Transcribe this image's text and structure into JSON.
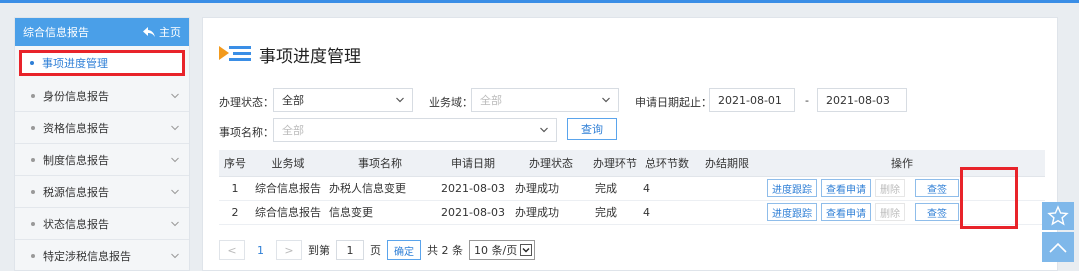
{
  "sidebar": {
    "header_title": "综合信息报告",
    "home_label": "主页",
    "items": [
      {
        "label": "事项进度管理",
        "active": true
      },
      {
        "label": "身份信息报告"
      },
      {
        "label": "资格信息报告"
      },
      {
        "label": "制度信息报告"
      },
      {
        "label": "税源信息报告"
      },
      {
        "label": "状态信息报告"
      },
      {
        "label": "特定涉税信息报告"
      }
    ]
  },
  "main": {
    "title": "事项进度管理",
    "filters": {
      "status_label": "办理状态：",
      "status_value": "全部",
      "domain_label": "业务域：",
      "domain_placeholder": "全部",
      "date_label": "申请日期起止：",
      "date_from": "2021-08-01",
      "date_sep": "-",
      "date_to": "2021-08-03",
      "name_label": "事项名称：",
      "name_placeholder": "全部",
      "query_button": "查询"
    },
    "table": {
      "headers": [
        "序号",
        "业务域",
        "事项名称",
        "申请日期",
        "办理状态",
        "办理环节",
        "总环节数",
        "办结期限",
        "操作"
      ],
      "rows": [
        {
          "no": "1",
          "domain": "综合信息报告",
          "name": "办税人信息变更",
          "date": "2021-08-03",
          "status": "办理成功",
          "stage": "完成",
          "total": "4",
          "deadline": ""
        },
        {
          "no": "2",
          "domain": "综合信息报告",
          "name": "信息变更",
          "date": "2021-08-03",
          "status": "办理成功",
          "stage": "完成",
          "total": "4",
          "deadline": ""
        }
      ],
      "actions": {
        "track": "进度跟踪",
        "view": "查看申请",
        "delete": "删除",
        "sign": "查签"
      }
    },
    "pager": {
      "prev": "<",
      "page": "1",
      "next": ">",
      "goto_label": "到第",
      "goto_value": "1",
      "page_unit": "页",
      "confirm": "确定",
      "total": "共 2 条",
      "page_size": "10 条/页"
    }
  },
  "colors": {
    "accent": "#4a9fe8",
    "highlight": "#e8232a",
    "link": "#2f7fd6"
  }
}
